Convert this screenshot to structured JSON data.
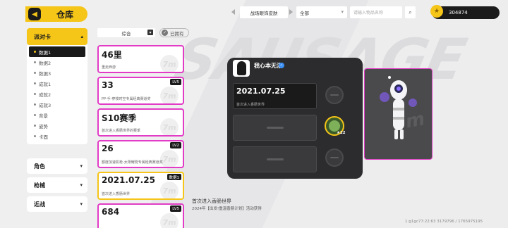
{
  "header": {
    "title": "仓库",
    "back_icon": "back-arrow-icon"
  },
  "topbar": {
    "tab_selected": "战场眼饰皮肤",
    "filter_all": "全部",
    "search_placeholder": "请输入物品名称",
    "currency_value": "304874"
  },
  "nav": {
    "section": "派对卡",
    "items": [
      {
        "label": "数据1",
        "active": true
      },
      {
        "label": "数据2",
        "active": false
      },
      {
        "label": "数据3",
        "active": false
      },
      {
        "label": "成就1",
        "active": false
      },
      {
        "label": "成就2",
        "active": false
      },
      {
        "label": "成就3",
        "active": false
      },
      {
        "label": "背景",
        "active": false
      },
      {
        "label": "姿势",
        "active": false
      },
      {
        "label": "卡面",
        "active": false
      }
    ],
    "categories": [
      "角色",
      "枪械",
      "近战"
    ]
  },
  "filters": {
    "sort": "综合",
    "owned": "已拥有"
  },
  "cards": [
    {
      "value": "46里",
      "desc": "重走西游",
      "badge": "",
      "selected": false
    },
    {
      "value": "33",
      "desc": "PP-手-穿梭时空专属经典赛道奖",
      "badge": "LV5",
      "selected": false
    },
    {
      "value": "S10赛季",
      "desc": "首次进入香肠世界的赛季",
      "badge": "",
      "selected": false
    },
    {
      "value": "26",
      "desc": "额度加速机枪-太阳耀斑专属经典赛道奖",
      "badge": "LV2",
      "selected": false
    },
    {
      "value": "2021.07.25",
      "desc": "首次进入香肠世界",
      "badge": "数据1",
      "selected": true
    },
    {
      "value": "684",
      "desc": "",
      "badge": "LV5",
      "selected": false
    }
  ],
  "card_watermark": "7m",
  "detail": {
    "player_name": "我心本无泪",
    "main_value": "2021.07.25",
    "main_desc": "首次进入香肠世界",
    "level": "22"
  },
  "description": {
    "title": "首次进入香肠世界",
    "body": "2024年【出发!重温香肠计划】活动获得"
  },
  "uid": "1:g1gc77:22:63 3179796 / 1765975195",
  "background_logo": "SAUSAGE",
  "colors": {
    "accent": "#f5c518",
    "rarity": "#e23bc6",
    "panel": "#2c2c2e"
  }
}
